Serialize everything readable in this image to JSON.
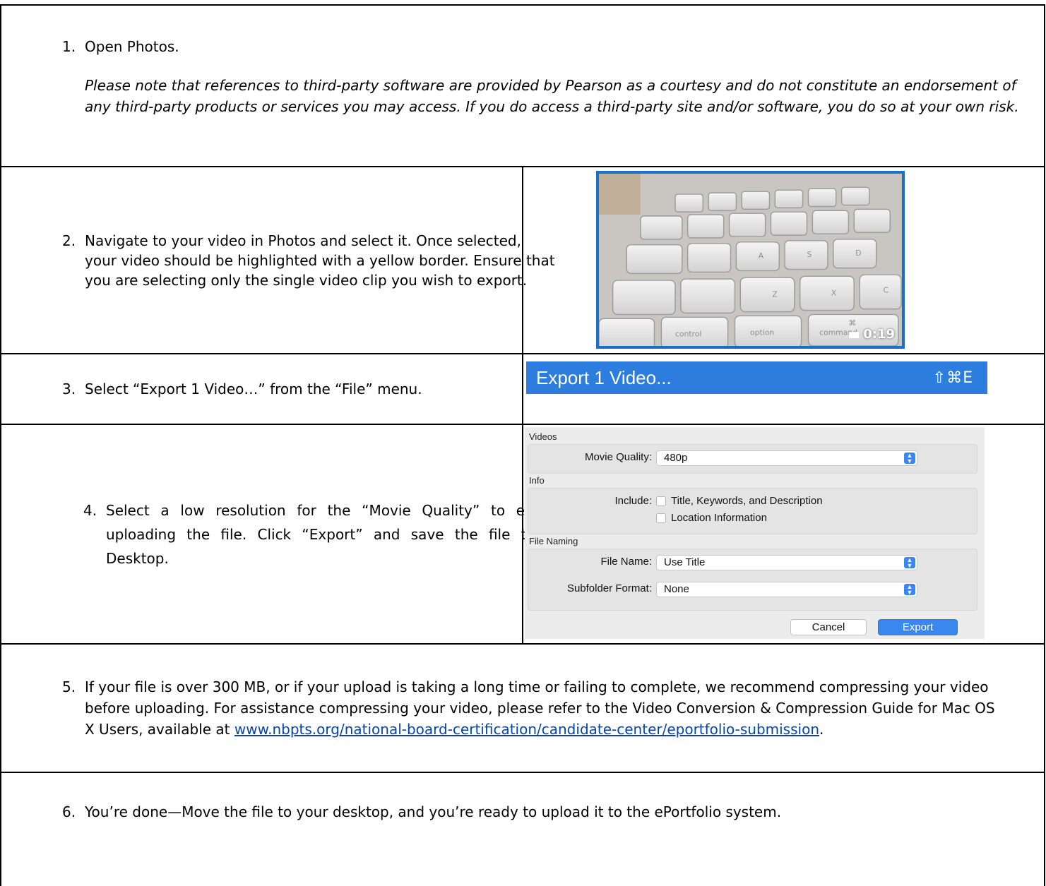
{
  "steps": {
    "s1": {
      "num": "1.",
      "text": "Open Photos."
    },
    "note": "Please note that references to third-party software are provided by Pearson as a courtesy and do not constitute an endorsement of any third-party products or services you may access. If you do access a third-party site and/or software, you do so at your own risk.",
    "s2": {
      "num": "2.",
      "text": "Navigate to your video in Photos and select it. Once selected, your video should be highlighted with a yellow border. Ensure that you are selecting only the single video clip you wish to export."
    },
    "s3": {
      "num": "3.",
      "text": "Select “Export 1 Video…” from the “File” menu."
    },
    "s4": {
      "num": "4.",
      "text": "Select a low resolution for the “Movie Quality” to expedite uploading the file. Click “Export” and save the file to your Desktop."
    },
    "s5": {
      "num": "5.",
      "text_before": "If your file is over 300 MB, or if your upload is taking a long time or failing to complete, we recommend compressing your video before uploading. For assistance compressing your video, please refer to the Video Conversion & Compression Guide for Mac OS X Users, available at ",
      "link": "www.nbpts.org/national-board-certification/candidate-center/eportfolio-submission",
      "text_after": "."
    },
    "s6": {
      "num": "6.",
      "text": "You’re done—Move the file to your desktop, and you’re ready to upload it to the ePortfolio system."
    }
  },
  "thumbnail": {
    "duration": "0:19",
    "keys": [
      "control",
      "option",
      "command",
      "Z",
      "X",
      "C",
      "A",
      "S",
      "D",
      "⌘"
    ],
    "border_color": "#1a6fc7"
  },
  "menu_item": {
    "label": "Export 1 Video...",
    "shortcut": "⇧⌘E",
    "highlight_color": "#2d7ddf"
  },
  "dialog": {
    "videos_section": "Videos",
    "movie_quality_label": "Movie Quality:",
    "movie_quality_value": "480p",
    "info_section": "Info",
    "include_label": "Include:",
    "include_opt1": "Title, Keywords, and Description",
    "include_opt2": "Location Information",
    "file_naming_section": "File Naming",
    "file_name_label": "File Name:",
    "file_name_value": "Use Title",
    "subfolder_label": "Subfolder Format:",
    "subfolder_value": "None",
    "cancel_label": "Cancel",
    "export_label": "Export"
  }
}
